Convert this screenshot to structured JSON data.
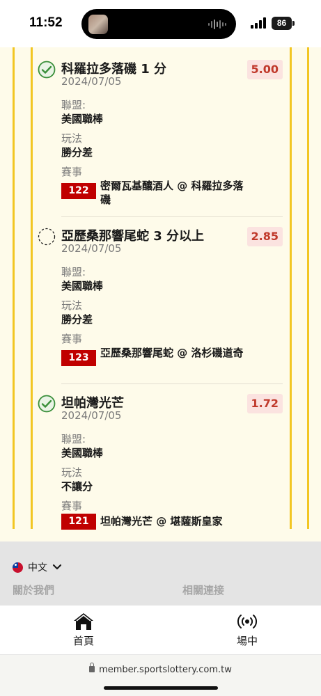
{
  "status_bar": {
    "time": "11:52",
    "battery": "86"
  },
  "bets": [
    {
      "status": "won",
      "title": "科羅拉多落磯 1 分",
      "date": "2024/07/05",
      "odds": "5.00",
      "league_label": "聯盟:",
      "league": "美國職棒",
      "play_label": "玩法",
      "play": "勝分差",
      "event_label": "賽事",
      "event_no": "122",
      "event": "密爾瓦基釀酒人 @ 科羅拉多落磯"
    },
    {
      "status": "pending",
      "title": "亞歷桑那響尾蛇 3 分以上",
      "date": "2024/07/05",
      "odds": "2.85",
      "league_label": "聯盟:",
      "league": "美國職棒",
      "play_label": "玩法",
      "play": "勝分差",
      "event_label": "賽事",
      "event_no": "123",
      "event": "亞歷桑那響尾蛇 @ 洛杉磯道奇"
    },
    {
      "status": "won",
      "title": "坦帕灣光芒",
      "date": "2024/07/05",
      "odds": "1.72",
      "league_label": "聯盟:",
      "league": "美國職棒",
      "play_label": "玩法",
      "play": "不讓分",
      "event_label": "賽事",
      "event_no": "121",
      "event": "坦帕灣光芒 @ 堪薩斯皇家"
    }
  ],
  "footer": {
    "language": "中文",
    "about": "關於我們",
    "links": "相關連接"
  },
  "bottom_nav": [
    {
      "label": "首頁",
      "icon": "home-icon"
    },
    {
      "label": "場中",
      "icon": "live-broadcast-icon"
    }
  ],
  "url_bar": {
    "url": "member.sportslottery.com.tw"
  },
  "colors": {
    "rail": "#f2c623",
    "card_bg": "#fefbea",
    "odds_text": "#c0392b",
    "odds_bg": "#fbe3e0",
    "badge": "#c00000",
    "won_check": "#3a8f3a"
  }
}
